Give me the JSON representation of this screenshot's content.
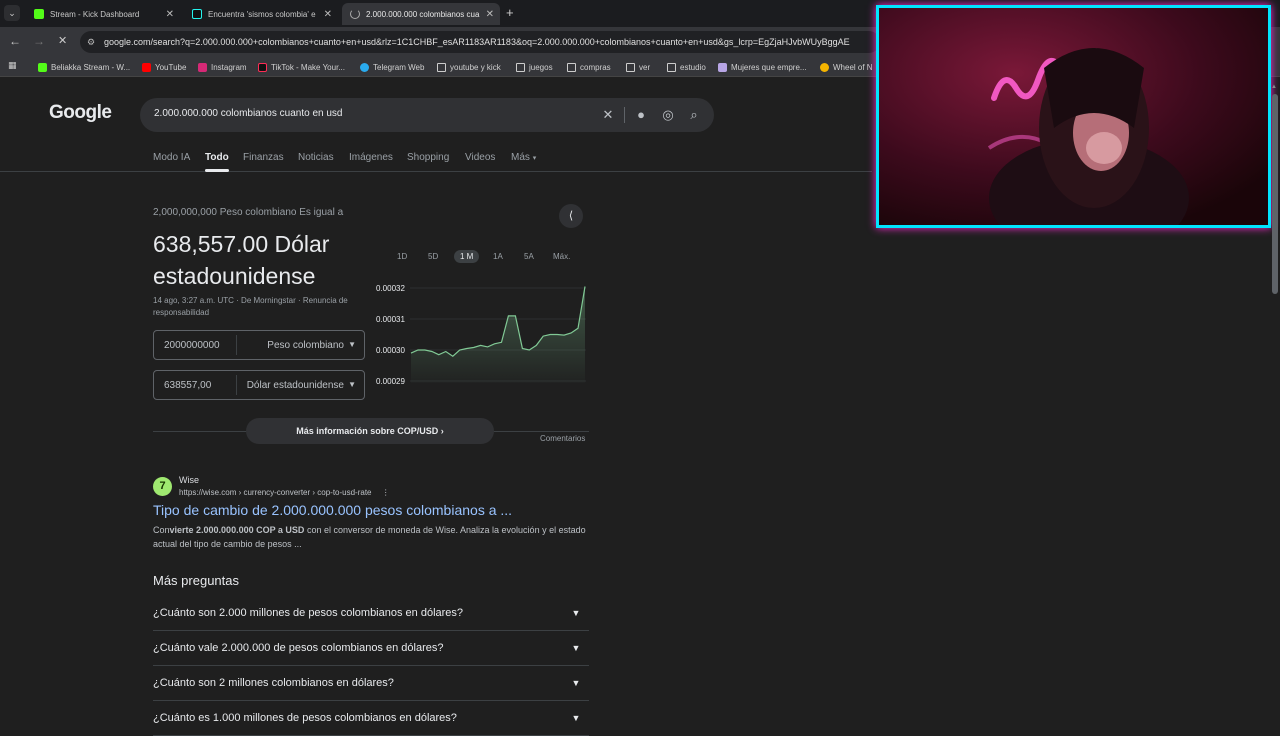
{
  "tabs": [
    {
      "title": "Stream - Kick Dashboard",
      "icon": "kick-icon"
    },
    {
      "title": "Encuentra 'sismos colombia' e",
      "icon": "tiktok-icon"
    },
    {
      "title": "2.000.000.000 colombianos cua",
      "icon": "loading-icon"
    }
  ],
  "omnibox": {
    "url": "google.com/search?q=2.000.000.000+colombianos+cuanto+en+usd&rlz=1C1CHBF_esAR1183AR1183&oq=2.000.000.000+colombianos+cuanto+en+usd&gs_lcrp=EgZjaHJvbWUyBggAE"
  },
  "bookmarks": [
    {
      "label": "Beliakka Stream - W...",
      "icon": "kick-icon"
    },
    {
      "label": "YouTube",
      "icon": "youtube-icon"
    },
    {
      "label": "Instagram",
      "icon": "instagram-icon"
    },
    {
      "label": "TikTok - Make Your...",
      "icon": "tiktok-icon"
    },
    {
      "label": "Telegram Web",
      "icon": "telegram-icon"
    },
    {
      "label": "youtube y kick",
      "icon": "folder-icon"
    },
    {
      "label": "juegos",
      "icon": "folder-icon"
    },
    {
      "label": "compras",
      "icon": "folder-icon"
    },
    {
      "label": "ver",
      "icon": "folder-icon"
    },
    {
      "label": "estudio",
      "icon": "folder-icon"
    },
    {
      "label": "Mujeres que empre...",
      "icon": "m-icon"
    },
    {
      "label": "Wheel of N",
      "icon": "wheel-icon"
    }
  ],
  "google": {
    "logo": "Google",
    "query": "2.000.000.000 colombianos cuanto en usd",
    "nav": [
      "Modo IA",
      "Todo",
      "Finanzas",
      "Noticias",
      "Imágenes",
      "Shopping",
      "Videos",
      "Más"
    ],
    "nav_selected": "Todo"
  },
  "converter": {
    "equal_label": "2,000,000,000 Peso colombiano Es igual a",
    "result": "638,557.00 Dólar estadounidense",
    "dateline": "14 ago, 3:27 a.m. UTC · De Morningstar · Renuncia de responsabilidad",
    "from_value": "2000000000",
    "from_currency": "Peso colombiano",
    "to_value": "638557,00",
    "to_currency": "Dólar estadounidense",
    "ranges": [
      "1D",
      "5D",
      "1 M",
      "1A",
      "5A",
      "Máx."
    ],
    "range_selected": "1 M",
    "more_info": "Más información sobre COP/USD",
    "comments": "Comentarios"
  },
  "chart_data": {
    "type": "area",
    "y_ticks": [
      "0.00032",
      "0.00031",
      "0.00030",
      "0.00029"
    ],
    "ylim": [
      0.00029,
      0.00032
    ],
    "values": [
      0.000299,
      0.0003,
      0.0003,
      0.0002995,
      0.0002985,
      0.0002995,
      0.000298,
      0.0003,
      0.0003005,
      0.0003008,
      0.0003015,
      0.000301,
      0.000302,
      0.0003025,
      0.000311,
      0.000311,
      0.0003005,
      0.0003,
      0.0003015,
      0.0003045,
      0.000305,
      0.000305,
      0.0003048,
      0.0003055,
      0.000307,
      0.0003205
    ],
    "color": "#81c995"
  },
  "result": {
    "site_name": "Wise",
    "site_url": "https://wise.com › currency-converter › cop-to-usd-rate",
    "title": "Tipo de cambio de 2.000.000.000 pesos colombianos a ...",
    "snippet_pre": "Con",
    "snippet_bold": "vierte 2.000.000.000 COP a USD",
    "snippet_post": " con el conversor de moneda de Wise. Analiza la evolución y el estado actual del tipo de cambio de pesos ..."
  },
  "paa": {
    "title": "Más preguntas",
    "questions": [
      "¿Cuánto son 2.000 millones de pesos colombianos en dólares?",
      "¿Cuánto vale 2.000.000 de pesos colombianos en dólares?",
      "¿Cuánto son 2 millones colombianos en dólares?",
      "¿Cuánto es 1.000 millones de pesos colombianos en dólares?"
    ]
  }
}
